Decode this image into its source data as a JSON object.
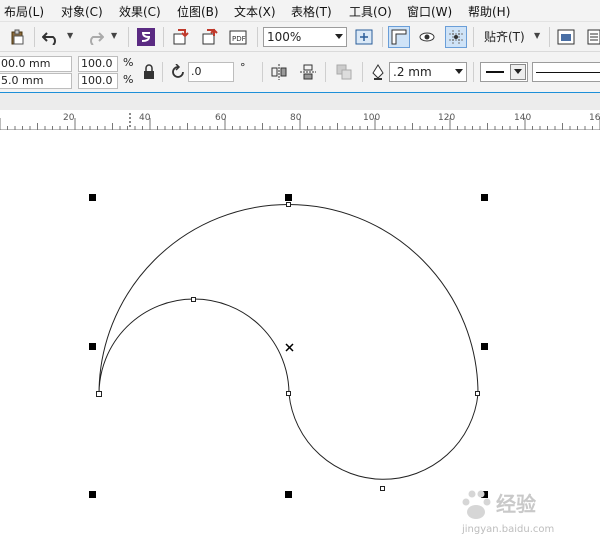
{
  "menubar": {
    "items": [
      {
        "label": "布局(L)"
      },
      {
        "label": "对象(C)"
      },
      {
        "label": "效果(C)"
      },
      {
        "label": "位图(B)"
      },
      {
        "label": "文本(X)"
      },
      {
        "label": "表格(T)"
      },
      {
        "label": "工具(O)"
      },
      {
        "label": "窗口(W)"
      },
      {
        "label": "帮助(H)"
      }
    ]
  },
  "toolbar": {
    "zoom_value": "100%",
    "snap_label": "贴齐(T)",
    "icons": [
      "paste-icon",
      "undo-icon",
      "redo-icon",
      "launcher-icon",
      "import-icon",
      "export-icon",
      "publish-pdf-icon",
      "full-screen-icon",
      "show-rulers-icon",
      "view-icon",
      "grid-icon",
      "options-icon"
    ]
  },
  "propbar": {
    "width_value": "00.0 mm",
    "height_value": "5.0 mm",
    "scale_x": "100.0",
    "scale_y": "100.0",
    "percent_symbol": "%",
    "rotation_value": ".0",
    "degree_symbol": "°",
    "outline_width": ".2 mm"
  },
  "ruler": {
    "labels": [
      "20",
      "40",
      "60",
      "80",
      "100",
      "120",
      "140",
      "16"
    ]
  },
  "watermark": {
    "brand": "经验",
    "url": "jingyan.baidu.com"
  }
}
